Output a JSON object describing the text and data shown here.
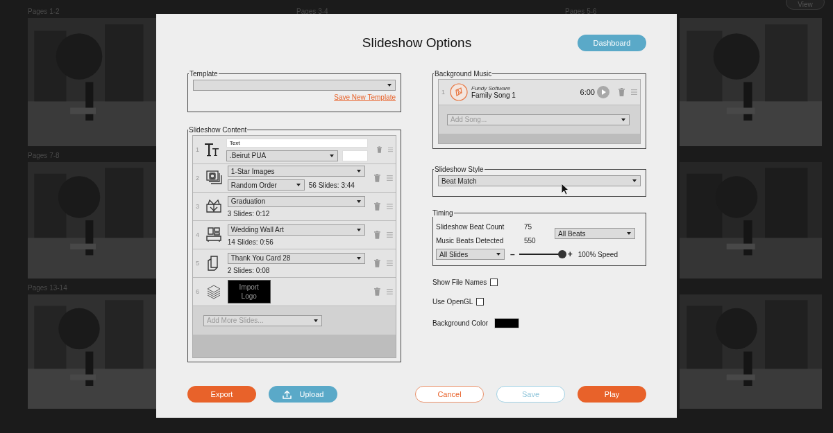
{
  "backdrop": {
    "view_button": "View",
    "spreads": [
      {
        "label": "Pages 1-2",
        "kind": "picture"
      },
      {
        "label": "Pages 3-4"
      },
      {
        "label": "Pages 5-6",
        "kind": "picture"
      },
      {
        "label": "Pages 7-8",
        "kind": "picture"
      },
      {
        "kind": "picture"
      },
      {
        "label": "Pages 13-14",
        "kind": "picture"
      },
      {
        "kind": "picture"
      }
    ]
  },
  "dialog": {
    "title": "Slideshow Options",
    "dashboard_button": "Dashboard",
    "template": {
      "legend": "Template",
      "link": "Save New Template"
    },
    "content": {
      "legend": "Slideshow Content",
      "items": [
        {
          "kind": "text",
          "number": "1",
          "text_value": "Text",
          "font": ".Beirut PUA"
        },
        {
          "kind": "collection",
          "number": "2",
          "source": "1-Star Images",
          "order": "Random Order",
          "count": "56 Slides: 3:44"
        },
        {
          "kind": "template",
          "number": "3",
          "template": "Graduation",
          "count": "3 Slides: 0:12"
        },
        {
          "kind": "template",
          "number": "4",
          "template": "Wedding Wall Art",
          "count": "14 Slides: 0:56"
        },
        {
          "kind": "template",
          "number": "5",
          "template": "Thank You Card 28",
          "count": "2 Slides: 0:08"
        },
        {
          "kind": "logo",
          "number": "6",
          "button": "Import Logo"
        }
      ],
      "add_placeholder": "Add More Slides..."
    },
    "music": {
      "legend": "Background Music",
      "songs": [
        {
          "number": "1",
          "artist": "Fundy Software",
          "title": "Family Song 1",
          "duration": "6:00"
        }
      ],
      "add_placeholder": "Add Song..."
    },
    "style": {
      "legend": "Slideshow Style",
      "value": "Beat Match"
    },
    "timing": {
      "legend": "Timing",
      "stats": [
        {
          "label": "Slideshow Beat Count",
          "value": "75"
        },
        {
          "label": "Music Beats Detected",
          "value": "550"
        }
      ],
      "beats": "All Beats",
      "slides": "All Slides",
      "minus": "–",
      "plus": "+",
      "speed": {
        "level": 1
      },
      "speed_reading": "100% Speed"
    },
    "options": [
      {
        "label": "Show File Names",
        "checked": false
      },
      {
        "label": "Use OpenGL",
        "checked": false
      }
    ],
    "background_color": {
      "label": "Background Color",
      "color": "#000000"
    },
    "buttons": {
      "export": "Export",
      "upload": "Upload",
      "cancel": "Cancel",
      "save": "Save",
      "play": "Play"
    }
  }
}
